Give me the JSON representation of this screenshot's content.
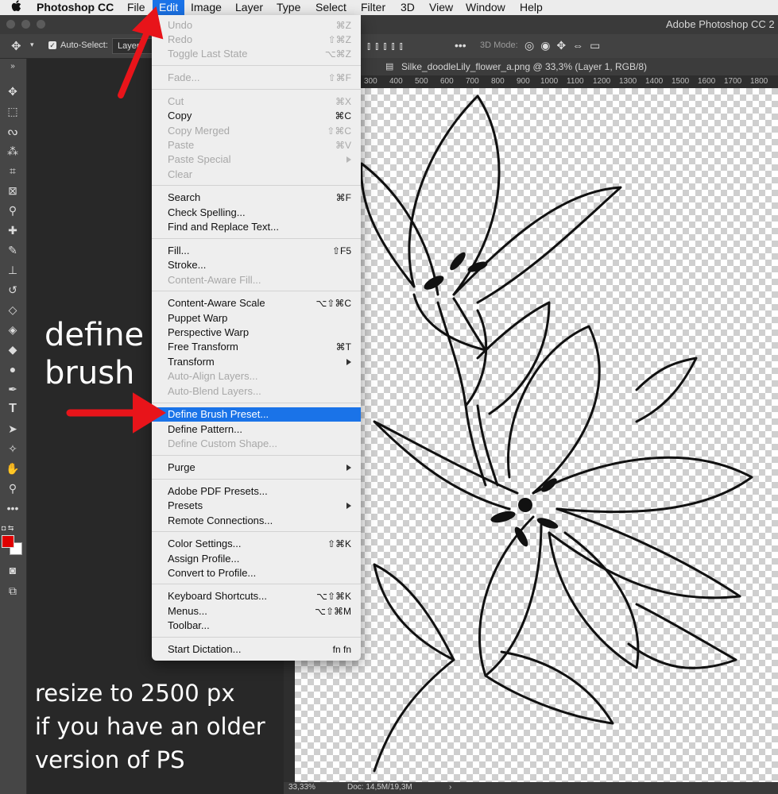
{
  "menubar": {
    "items": [
      "Photoshop CC",
      "File",
      "Edit",
      "Image",
      "Layer",
      "Type",
      "Select",
      "Filter",
      "3D",
      "View",
      "Window",
      "Help"
    ],
    "active": "Edit"
  },
  "window": {
    "title": "Adobe Photoshop CC 2"
  },
  "options_bar": {
    "auto_select_label": "Auto-Select:",
    "auto_select_value": "Layer",
    "mode_3d_label": "3D Mode:"
  },
  "document": {
    "tab_title": "Silke_doodleLily_flower_a.png @ 33,3% (Layer 1, RGB/8)",
    "ruler_ticks": [
      "300",
      "400",
      "500",
      "600",
      "700",
      "800",
      "900",
      "1000",
      "1100",
      "1200",
      "1300",
      "1400",
      "1500",
      "1600",
      "1700",
      "1800"
    ],
    "zoom": "33,33%",
    "doc_info": "Doc: 14,5M/19,3M"
  },
  "edit_menu": {
    "items": [
      {
        "label": "Undo",
        "shortcut": "⌘Z",
        "state": "disabled"
      },
      {
        "label": "Redo",
        "shortcut": "⇧⌘Z",
        "state": "disabled"
      },
      {
        "label": "Toggle Last State",
        "shortcut": "⌥⌘Z",
        "state": "disabled"
      },
      {
        "sep": true
      },
      {
        "label": "Fade...",
        "shortcut": "⇧⌘F",
        "state": "disabled"
      },
      {
        "sep": true
      },
      {
        "label": "Cut",
        "shortcut": "⌘X",
        "state": "disabled"
      },
      {
        "label": "Copy",
        "shortcut": "⌘C",
        "state": "enabled"
      },
      {
        "label": "Copy Merged",
        "shortcut": "⇧⌘C",
        "state": "disabled"
      },
      {
        "label": "Paste",
        "shortcut": "⌘V",
        "state": "disabled"
      },
      {
        "label": "Paste Special",
        "shortcut": "",
        "state": "disabled",
        "submenu": true
      },
      {
        "label": "Clear",
        "shortcut": "",
        "state": "disabled"
      },
      {
        "sep": true
      },
      {
        "label": "Search",
        "shortcut": "⌘F",
        "state": "enabled"
      },
      {
        "label": "Check Spelling...",
        "shortcut": "",
        "state": "enabled"
      },
      {
        "label": "Find and Replace Text...",
        "shortcut": "",
        "state": "enabled"
      },
      {
        "sep": true
      },
      {
        "label": "Fill...",
        "shortcut": "⇧F5",
        "state": "enabled"
      },
      {
        "label": "Stroke...",
        "shortcut": "",
        "state": "enabled"
      },
      {
        "label": "Content-Aware Fill...",
        "shortcut": "",
        "state": "disabled"
      },
      {
        "sep": true
      },
      {
        "label": "Content-Aware Scale",
        "shortcut": "⌥⇧⌘C",
        "state": "enabled"
      },
      {
        "label": "Puppet Warp",
        "shortcut": "",
        "state": "enabled"
      },
      {
        "label": "Perspective Warp",
        "shortcut": "",
        "state": "enabled"
      },
      {
        "label": "Free Transform",
        "shortcut": "⌘T",
        "state": "enabled"
      },
      {
        "label": "Transform",
        "shortcut": "",
        "state": "enabled",
        "submenu": true
      },
      {
        "label": "Auto-Align Layers...",
        "shortcut": "",
        "state": "disabled"
      },
      {
        "label": "Auto-Blend Layers...",
        "shortcut": "",
        "state": "disabled"
      },
      {
        "sep": true
      },
      {
        "label": "Define Brush Preset...",
        "shortcut": "",
        "state": "selected"
      },
      {
        "label": "Define Pattern...",
        "shortcut": "",
        "state": "enabled"
      },
      {
        "label": "Define Custom Shape...",
        "shortcut": "",
        "state": "disabled"
      },
      {
        "sep": true
      },
      {
        "label": "Purge",
        "shortcut": "",
        "state": "enabled",
        "submenu": true
      },
      {
        "sep": true
      },
      {
        "label": "Adobe PDF Presets...",
        "shortcut": "",
        "state": "enabled"
      },
      {
        "label": "Presets",
        "shortcut": "",
        "state": "enabled",
        "submenu": true
      },
      {
        "label": "Remote Connections...",
        "shortcut": "",
        "state": "enabled"
      },
      {
        "sep": true
      },
      {
        "label": "Color Settings...",
        "shortcut": "⇧⌘K",
        "state": "enabled"
      },
      {
        "label": "Assign Profile...",
        "shortcut": "",
        "state": "enabled"
      },
      {
        "label": "Convert to Profile...",
        "shortcut": "",
        "state": "enabled"
      },
      {
        "sep": true
      },
      {
        "label": "Keyboard Shortcuts...",
        "shortcut": "⌥⇧⌘K",
        "state": "enabled"
      },
      {
        "label": "Menus...",
        "shortcut": "⌥⇧⌘M",
        "state": "enabled"
      },
      {
        "label": "Toolbar...",
        "shortcut": "",
        "state": "enabled"
      },
      {
        "sep": true
      },
      {
        "label": "Start Dictation...",
        "shortcut": "fn fn",
        "state": "enabled"
      }
    ]
  },
  "annotations": {
    "define_brush_line1": "define",
    "define_brush_line2": "brush",
    "resize_line1": "resize to 2500 px",
    "resize_line2": "if you have an older",
    "resize_line3": "version of PS"
  },
  "colors": {
    "selection": "#1a73e8",
    "arrow": "#e8141a",
    "foreground_swatch": "#e00000"
  }
}
